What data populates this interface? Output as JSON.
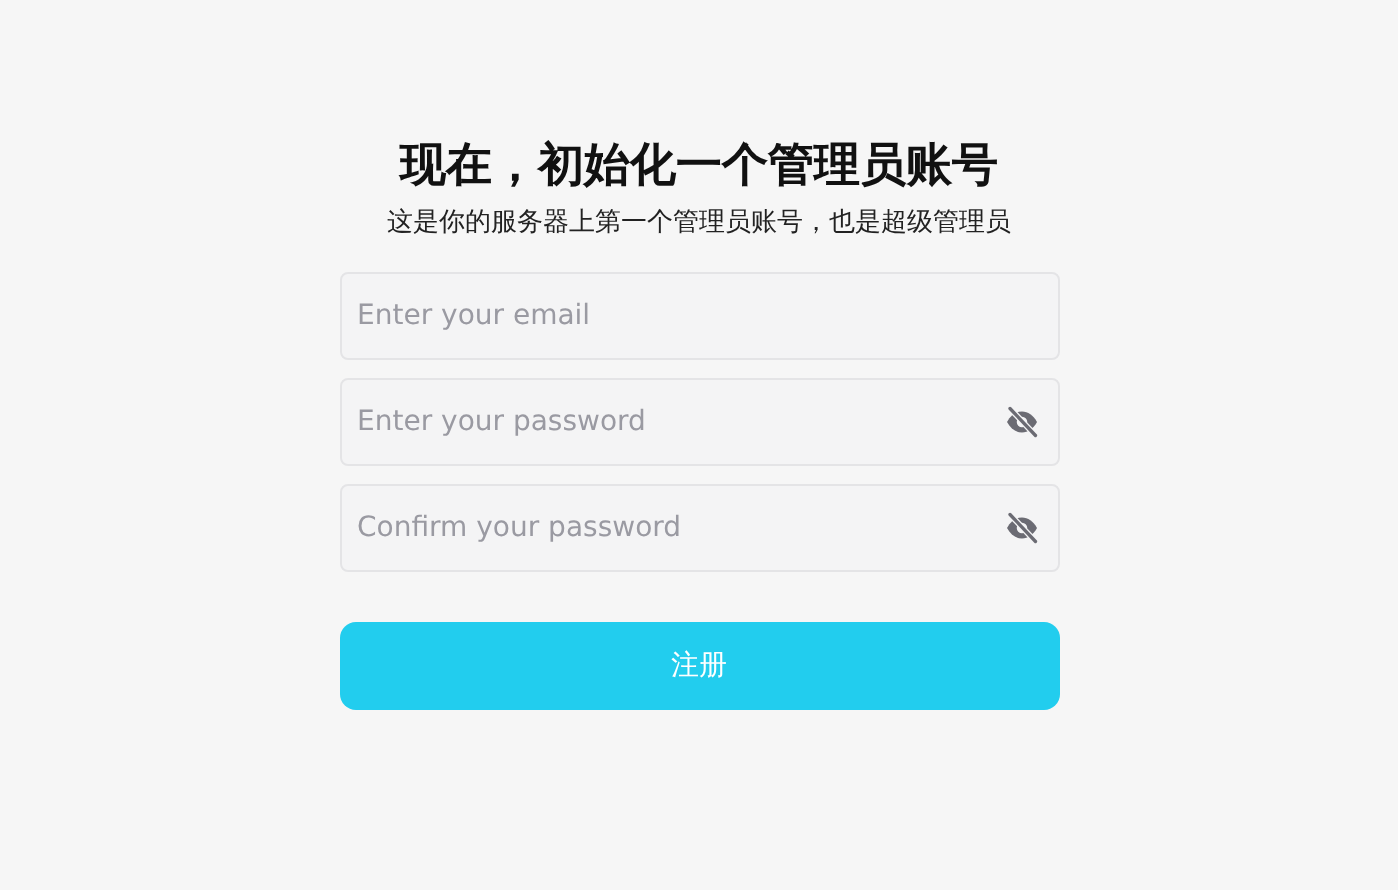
{
  "title": "现在，初始化一个管理员账号",
  "subtitle": "这是你的服务器上第一个管理员账号，也是超级管理员",
  "fields": [
    {
      "kind": "email",
      "placeholder": "Enter your email"
    },
    {
      "kind": "password",
      "placeholder": "Enter your password"
    },
    {
      "kind": "password",
      "placeholder": "Confirm your password"
    }
  ],
  "submit_button": "注册"
}
